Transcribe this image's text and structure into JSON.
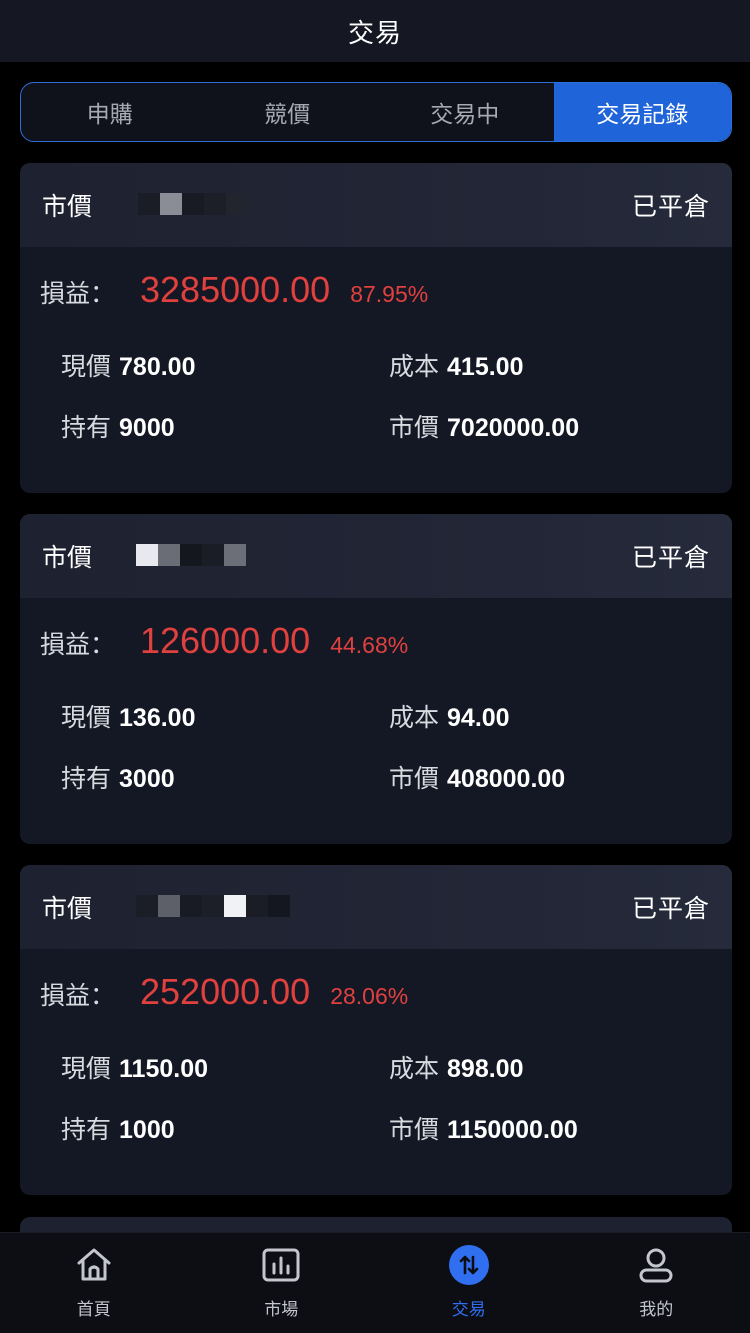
{
  "header": {
    "title": "交易"
  },
  "tabs": [
    {
      "label": "申購",
      "active": false
    },
    {
      "label": "競價",
      "active": false
    },
    {
      "label": "交易中",
      "active": false
    },
    {
      "label": "交易記錄",
      "active": true
    }
  ],
  "labels": {
    "pl": "損益：",
    "price": "現價",
    "cost": "成本",
    "hold": "持有",
    "market_value": "市價"
  },
  "records": [
    {
      "type": "市價",
      "status": "已平倉",
      "pl_amount": "3285000.00",
      "pl_pct": "87.95%",
      "price": "780.00",
      "cost": "415.00",
      "hold": "9000",
      "market_value": "7020000.00"
    },
    {
      "type": "市價",
      "status": "已平倉",
      "pl_amount": "126000.00",
      "pl_pct": "44.68%",
      "price": "136.00",
      "cost": "94.00",
      "hold": "3000",
      "market_value": "408000.00"
    },
    {
      "type": "市價",
      "status": "已平倉",
      "pl_amount": "252000.00",
      "pl_pct": "28.06%",
      "price": "1150.00",
      "cost": "898.00",
      "hold": "1000",
      "market_value": "1150000.00"
    }
  ],
  "tabbar": [
    {
      "label": "首頁",
      "icon": "home-icon",
      "active": false
    },
    {
      "label": "市場",
      "icon": "chart-icon",
      "active": false
    },
    {
      "label": "交易",
      "icon": "trade-icon",
      "active": true
    },
    {
      "label": "我的",
      "icon": "user-icon",
      "active": false
    }
  ],
  "colors": {
    "accent": "#1f64d8",
    "loss_profit_red": "#e0413f",
    "card_bg": "#141824",
    "active_tab_text": "#2f6ff0"
  }
}
